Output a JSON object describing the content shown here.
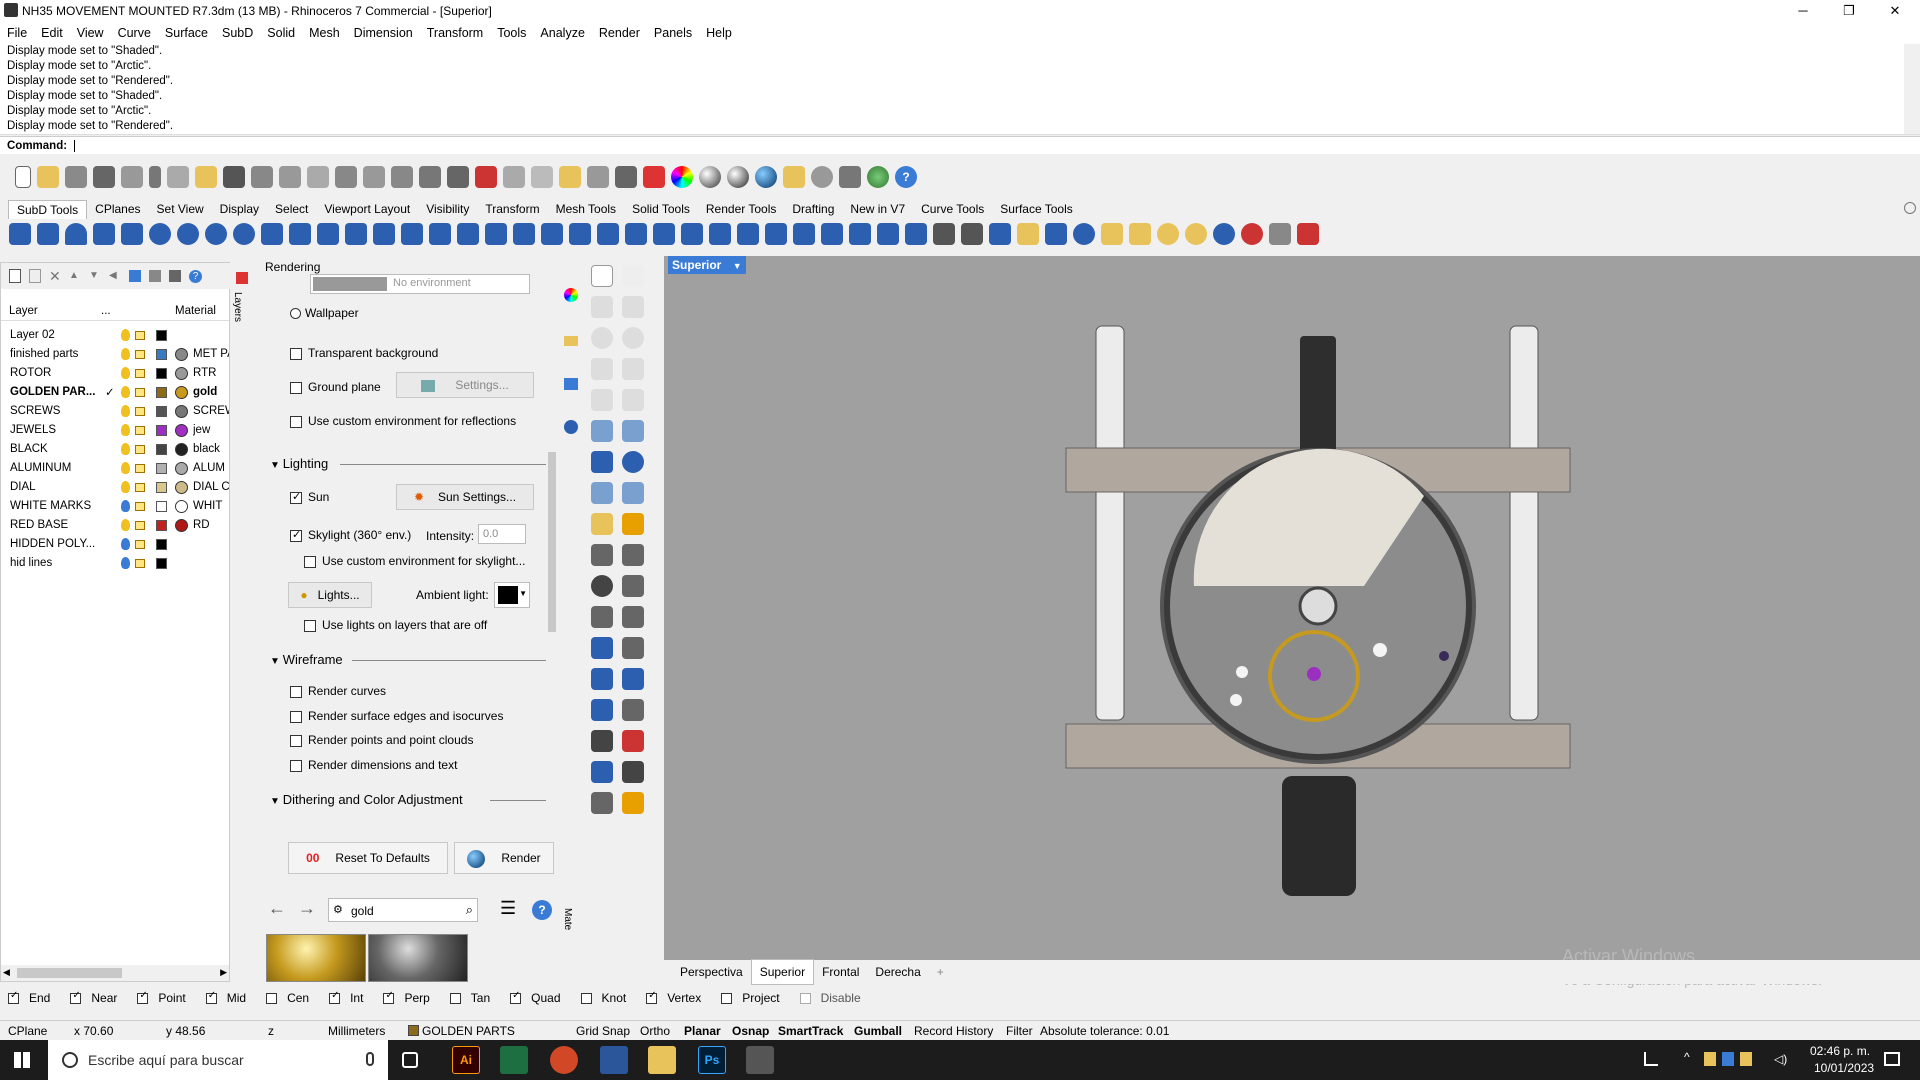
{
  "titlebar": {
    "title": "NH35 MOVEMENT MOUNTED R7.3dm (13 MB) - Rhinoceros 7 Commercial - [Superior]",
    "minimize": "─",
    "maximize": "❐",
    "close": "✕"
  },
  "menu": [
    "File",
    "Edit",
    "View",
    "Curve",
    "Surface",
    "SubD",
    "Solid",
    "Mesh",
    "Dimension",
    "Transform",
    "Tools",
    "Analyze",
    "Render",
    "Panels",
    "Help"
  ],
  "history": [
    "Display mode set to \"Shaded\".",
    "Display mode set to \"Arctic\".",
    "Display mode set to \"Rendered\".",
    "Display mode set to \"Shaded\".",
    "Display mode set to \"Arctic\".",
    "Display mode set to \"Rendered\"."
  ],
  "command": {
    "label": "Command:"
  },
  "tabs": [
    "SubD Tools",
    "CPlanes",
    "Set View",
    "Display",
    "Select",
    "Viewport Layout",
    "Visibility",
    "Transform",
    "Mesh Tools",
    "Solid Tools",
    "Render Tools",
    "Drafting",
    "New in V7",
    "Curve Tools",
    "Surface Tools"
  ],
  "layers": {
    "headers": {
      "layer": "Layer",
      "dots": "...",
      "material": "Material"
    },
    "rows": [
      {
        "name": "Layer 02",
        "color": "#000000",
        "bulb": "#f0c020",
        "material": "",
        "mcolor": "",
        "bold": false
      },
      {
        "name": "finished parts",
        "color": "#3a7bbf",
        "bulb": "#f0c020",
        "material": "MET PA",
        "mcolor": "#888888",
        "bold": false
      },
      {
        "name": "ROTOR",
        "color": "#000000",
        "bulb": "#f0c020",
        "material": "RTR",
        "mcolor": "#999999",
        "bold": false
      },
      {
        "name": "GOLDEN PAR...",
        "color": "#8b6a1a",
        "bulb": "#f0c020",
        "material": "gold",
        "mcolor": "#c79a1e",
        "bold": true,
        "check": "✓"
      },
      {
        "name": "SCREWS",
        "color": "#555555",
        "bulb": "#f0c020",
        "material": "SCREW",
        "mcolor": "#777777",
        "bold": false
      },
      {
        "name": "JEWELS",
        "color": "#9b30c0",
        "bulb": "#f0c020",
        "material": "jew",
        "mcolor": "#a030c0",
        "bold": false
      },
      {
        "name": "BLACK",
        "color": "#444444",
        "bulb": "#f0c020",
        "material": "black",
        "mcolor": "#222222",
        "bold": false
      },
      {
        "name": "ALUMINUM",
        "color": "#b0b0b0",
        "bulb": "#f0c020",
        "material": "ALUM",
        "mcolor": "#aaaaaa",
        "bold": false
      },
      {
        "name": "DIAL",
        "color": "#d8c890",
        "bulb": "#f0c020",
        "material": "DIAL C",
        "mcolor": "#ccbb88",
        "bold": false
      },
      {
        "name": "WHITE MARKS",
        "color": "#ffffff",
        "bulb": "#3a7bd5",
        "material": "WHIT",
        "mcolor": "#ffffff",
        "bold": false
      },
      {
        "name": "RED BASE",
        "color": "#c02020",
        "bulb": "#f0c020",
        "material": "RD",
        "mcolor": "#b01818",
        "bold": false
      },
      {
        "name": "HIDDEN POLY...",
        "color": "#000000",
        "bulb": "#3a7bd5",
        "material": "",
        "mcolor": "",
        "bold": false
      },
      {
        "name": "hid lines",
        "color": "#000000",
        "bulb": "#3a7bd5",
        "material": "",
        "mcolor": "",
        "bold": false
      }
    ],
    "vtab": "Layers"
  },
  "render": {
    "title": "Rendering",
    "env_placeholder": "No environment",
    "wallpaper": "Wallpaper",
    "transparent_bg": "Transparent background",
    "ground_plane": "Ground plane",
    "settings": "Settings...",
    "custom_env_refl": "Use custom environment for reflections",
    "lighting": "Lighting",
    "sun": "Sun",
    "sun_settings": "Sun Settings...",
    "skylight": "Skylight (360° env.)",
    "intensity_label": "Intensity:",
    "intensity_value": "0.0",
    "custom_env_sky": "Use custom environment for skylight...",
    "lights": "Lights...",
    "ambient": "Ambient light:",
    "lights_off": "Use lights on layers that are off",
    "wireframe": "Wireframe",
    "render_curves": "Render curves",
    "render_edges": "Render surface edges and isocurves",
    "render_points": "Render points and point clouds",
    "render_dims": "Render dimensions and text",
    "dithering": "Dithering and Color Adjustment",
    "reset": "Reset To Defaults",
    "render_btn": "Render"
  },
  "materials": {
    "search": "gold",
    "vtab": "Mate"
  },
  "viewport": {
    "name": "Superior",
    "tabs": [
      "Perspectiva",
      "Superior",
      "Frontal",
      "Derecha"
    ],
    "watermark1": "Activar Windows",
    "watermark2": "Ve a Configuración para activar Windows."
  },
  "osnaps": [
    {
      "label": "End",
      "on": true
    },
    {
      "label": "Near",
      "on": true
    },
    {
      "label": "Point",
      "on": true
    },
    {
      "label": "Mid",
      "on": true
    },
    {
      "label": "Cen",
      "on": false
    },
    {
      "label": "Int",
      "on": true
    },
    {
      "label": "Perp",
      "on": true
    },
    {
      "label": "Tan",
      "on": false
    },
    {
      "label": "Quad",
      "on": true
    },
    {
      "label": "Knot",
      "on": false
    },
    {
      "label": "Vertex",
      "on": true
    },
    {
      "label": "Project",
      "on": false
    },
    {
      "label": "Disable",
      "on": false
    }
  ],
  "status": {
    "cplane": "CPlane",
    "x": "x 70.60",
    "y": "y 48.56",
    "z": "z",
    "units": "Millimeters",
    "layer": "GOLDEN PARTS",
    "grid": "Grid Snap",
    "ortho": "Ortho",
    "planar": "Planar",
    "osnap": "Osnap",
    "smarttrack": "SmartTrack",
    "gumball": "Gumball",
    "history": "Record History",
    "filter": "Filter",
    "tolerance": "Absolute tolerance: 0.01"
  },
  "taskbar": {
    "search": "Escribe aquí para buscar",
    "time": "02:46 p. m.",
    "date": "10/01/2023"
  },
  "colors": {
    "viewport_bg": "#a0a0a0",
    "accent": "#3a7bd5"
  }
}
